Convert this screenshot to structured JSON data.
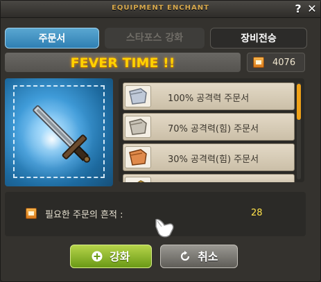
{
  "window": {
    "title": "EQUIPMENT ENCHANT",
    "help_glyph": "?",
    "close_glyph": "✕"
  },
  "tabs": [
    {
      "label": "주문서",
      "state": "active"
    },
    {
      "label": "스타포스 강화",
      "state": "disabled"
    },
    {
      "label": "장비전승",
      "state": "inactive"
    }
  ],
  "fever": {
    "text": "FEVER TIME !!"
  },
  "currency": {
    "icon": "scroll-trace-icon",
    "value": "4076"
  },
  "equipment": {
    "icon": "sword-icon"
  },
  "scrolls": [
    {
      "label": "100% 공격력 주문서",
      "icon": "scroll-icon",
      "tint": "#bfc9d8"
    },
    {
      "label": "70% 공격력(힘) 주문서",
      "icon": "scroll-icon",
      "tint": "#c7c2b6"
    },
    {
      "label": "30% 공격력(힘) 주문서",
      "icon": "scroll-icon",
      "tint": "#e08a4b"
    },
    {
      "label": "",
      "icon": "scroll-icon",
      "tint": "#e0b34b"
    }
  ],
  "cost": {
    "label": "필요한 주문의 흔적 :",
    "value": "28"
  },
  "buttons": {
    "enhance": {
      "icon": "plus-circle-icon",
      "label": "강화"
    },
    "cancel": {
      "icon": "refresh-icon",
      "label": "취소"
    }
  },
  "colors": {
    "accent_active_tab": "#2f7fb3",
    "fever": "#ffd200",
    "cost_value": "#ffe24a",
    "enhance_button": "#6a9a16"
  }
}
